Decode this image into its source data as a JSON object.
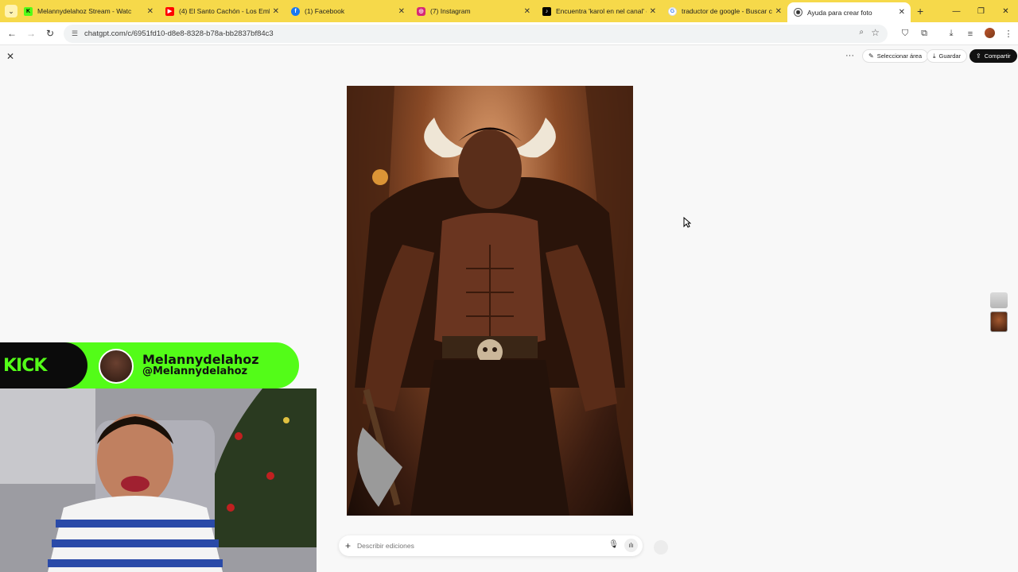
{
  "browser": {
    "tabs": [
      {
        "title": "Melannydelahoz Stream - Watc",
        "favicon_color": "#53fc18",
        "active": false
      },
      {
        "title": "(4) El Santo Cachón - Los Emba",
        "favicon_color": "#ff0000",
        "active": false
      },
      {
        "title": "(1) Facebook",
        "favicon_color": "#1877f2",
        "active": false
      },
      {
        "title": "(7) Instagram",
        "favicon_color": "#d62976",
        "active": false
      },
      {
        "title": "Encuentra 'karol en nel canal' e",
        "favicon_color": "#000000",
        "active": false
      },
      {
        "title": "traductor de google - Buscar c",
        "favicon_color": "#4285f4",
        "active": false
      },
      {
        "title": "Ayuda para crear foto",
        "favicon_color": "#333333",
        "active": true
      }
    ],
    "new_tab_icon": "plus-icon",
    "url": "chatgpt.com/c/6951fd10-d8e8-8328-b78a-bb2837bf84c3"
  },
  "viewer": {
    "select_area_label": "Seleccionar área",
    "save_label": "Guardar",
    "share_label": "Compartir"
  },
  "prompt": {
    "placeholder": "Describir ediciones"
  },
  "stream_overlay": {
    "platform_logo": "KICK",
    "display_name": "Melannydelahoz",
    "handle": "@Melannydelahoz",
    "accent_color": "#53fc18"
  },
  "colors": {
    "tab_strip": "#f6d94a",
    "share_button": "#111111"
  }
}
